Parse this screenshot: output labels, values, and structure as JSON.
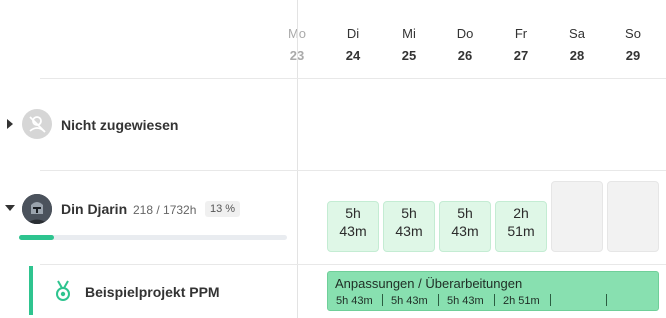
{
  "week": {
    "days": [
      {
        "name": "Mo",
        "num": "23"
      },
      {
        "name": "Di",
        "num": "24"
      },
      {
        "name": "Mi",
        "num": "25"
      },
      {
        "name": "Do",
        "num": "26"
      },
      {
        "name": "Fr",
        "num": "27"
      },
      {
        "name": "Sa",
        "num": "28"
      },
      {
        "name": "So",
        "num": "29"
      }
    ]
  },
  "unassigned": {
    "label": "Nicht zugewiesen",
    "icon": "person-off-icon"
  },
  "person": {
    "name": "Din Djarin",
    "hours": "218 / 1732h",
    "percent_label": "13 %",
    "progress": 0.13,
    "cells": [
      {
        "hours": "5h",
        "minutes": "43m"
      },
      {
        "hours": "5h",
        "minutes": "43m"
      },
      {
        "hours": "5h",
        "minutes": "43m"
      },
      {
        "hours": "2h",
        "minutes": "51m"
      }
    ]
  },
  "project": {
    "name": "Beispielprojekt PPM",
    "icon": "medal-icon",
    "accent_color": "#2ec48f",
    "task": {
      "title": "Anpassungen / Überarbeitungen",
      "segments": [
        "5h 43m",
        "5h 43m",
        "5h 43m",
        "2h 51m"
      ]
    }
  }
}
